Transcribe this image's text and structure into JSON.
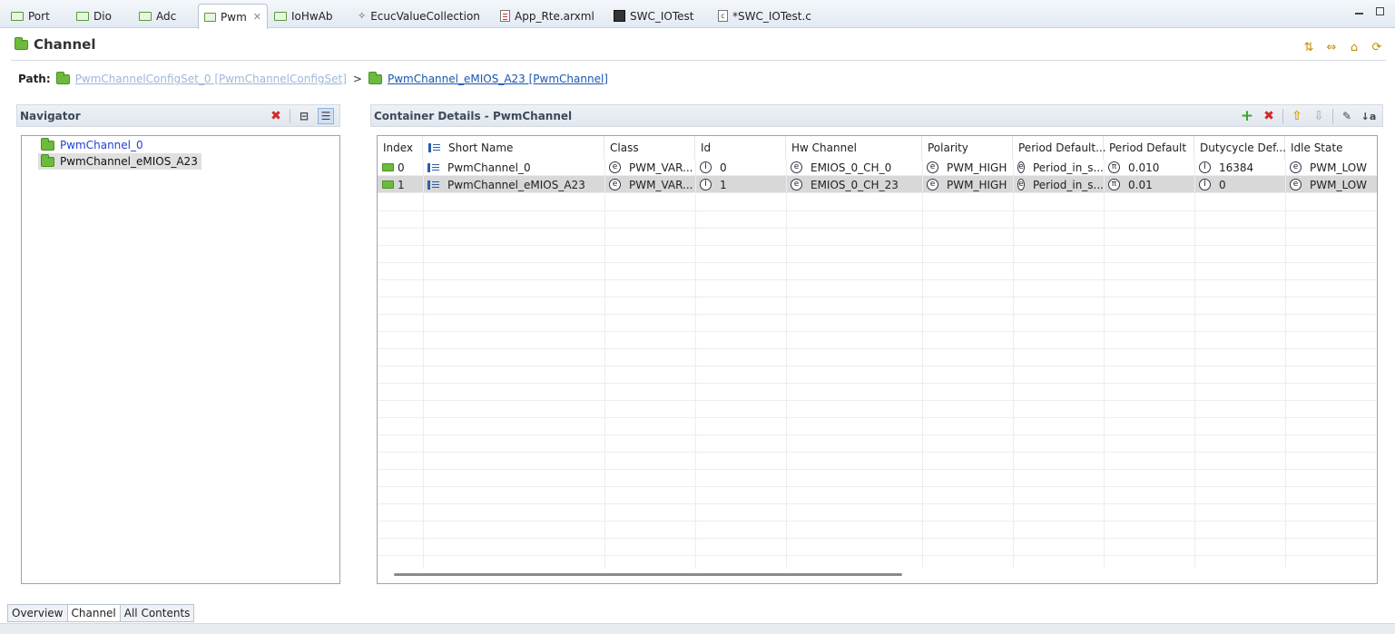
{
  "tabs": [
    {
      "label": "Port",
      "icon": "config-page-icon"
    },
    {
      "label": "Dio",
      "icon": "config-page-icon"
    },
    {
      "label": "Adc",
      "icon": "config-page-icon"
    },
    {
      "label": "Pwm",
      "icon": "config-page-icon",
      "active": true
    },
    {
      "label": "IoHwAb",
      "icon": "config-page-icon"
    },
    {
      "label": "EcucValueCollection",
      "icon": "diamond-icon"
    },
    {
      "label": "App_Rte.arxml",
      "icon": "arxml-file-icon"
    },
    {
      "label": "SWC_IOTest",
      "icon": "swc-icon"
    },
    {
      "label": "*SWC_IOTest.c",
      "icon": "c-file-icon"
    }
  ],
  "header": {
    "title": "Channel"
  },
  "path": {
    "label": "Path:",
    "parent": "PwmChannelConfigSet_0 [PwmChannelConfigSet]",
    "separator": ">",
    "current": "PwmChannel_eMIOS_A23 [PwmChannel]"
  },
  "navigator": {
    "title": "Navigator",
    "items": [
      {
        "label": "PwmChannel_0"
      },
      {
        "label": "PwmChannel_eMIOS_A23",
        "selected": true
      }
    ]
  },
  "details": {
    "title": "Container Details - PwmChannel",
    "columns": [
      "Index",
      "Short Name",
      "Class",
      "Id",
      "Hw Channel",
      "Polarity",
      "Period Default...",
      "Period Default",
      "Dutycycle Def...",
      "Idle State"
    ],
    "rows": [
      {
        "index": "0",
        "short_name": "PwmChannel_0",
        "class": "PWM_VAR...",
        "id": "0",
        "hw_channel": "EMIOS_0_CH_0",
        "polarity": "PWM_HIGH",
        "period_default_unit": "Period_in_s...",
        "period_default": "0.010",
        "dutycycle_default": "16384",
        "idle_state": "PWM_LOW"
      },
      {
        "index": "1",
        "short_name": "PwmChannel_eMIOS_A23",
        "class": "PWM_VAR...",
        "id": "1",
        "hw_channel": "EMIOS_0_CH_23",
        "polarity": "PWM_HIGH",
        "period_default_unit": "Period_in_s...",
        "period_default": "0.01",
        "dutycycle_default": "0",
        "idle_state": "PWM_LOW",
        "selected": true
      }
    ],
    "badges": {
      "enum": "e",
      "integer": "I",
      "float": "π"
    }
  },
  "bottom_tabs": [
    {
      "label": "Overview"
    },
    {
      "label": "Channel",
      "active": true
    },
    {
      "label": "All Contents"
    }
  ],
  "colors": {
    "folder": "#6cbb3c",
    "link": "#1a55b0",
    "link_dim": "#9db8d8",
    "delete": "#d42a2a",
    "add": "#3aa62a",
    "nav_blue": "#1f3fd0"
  }
}
